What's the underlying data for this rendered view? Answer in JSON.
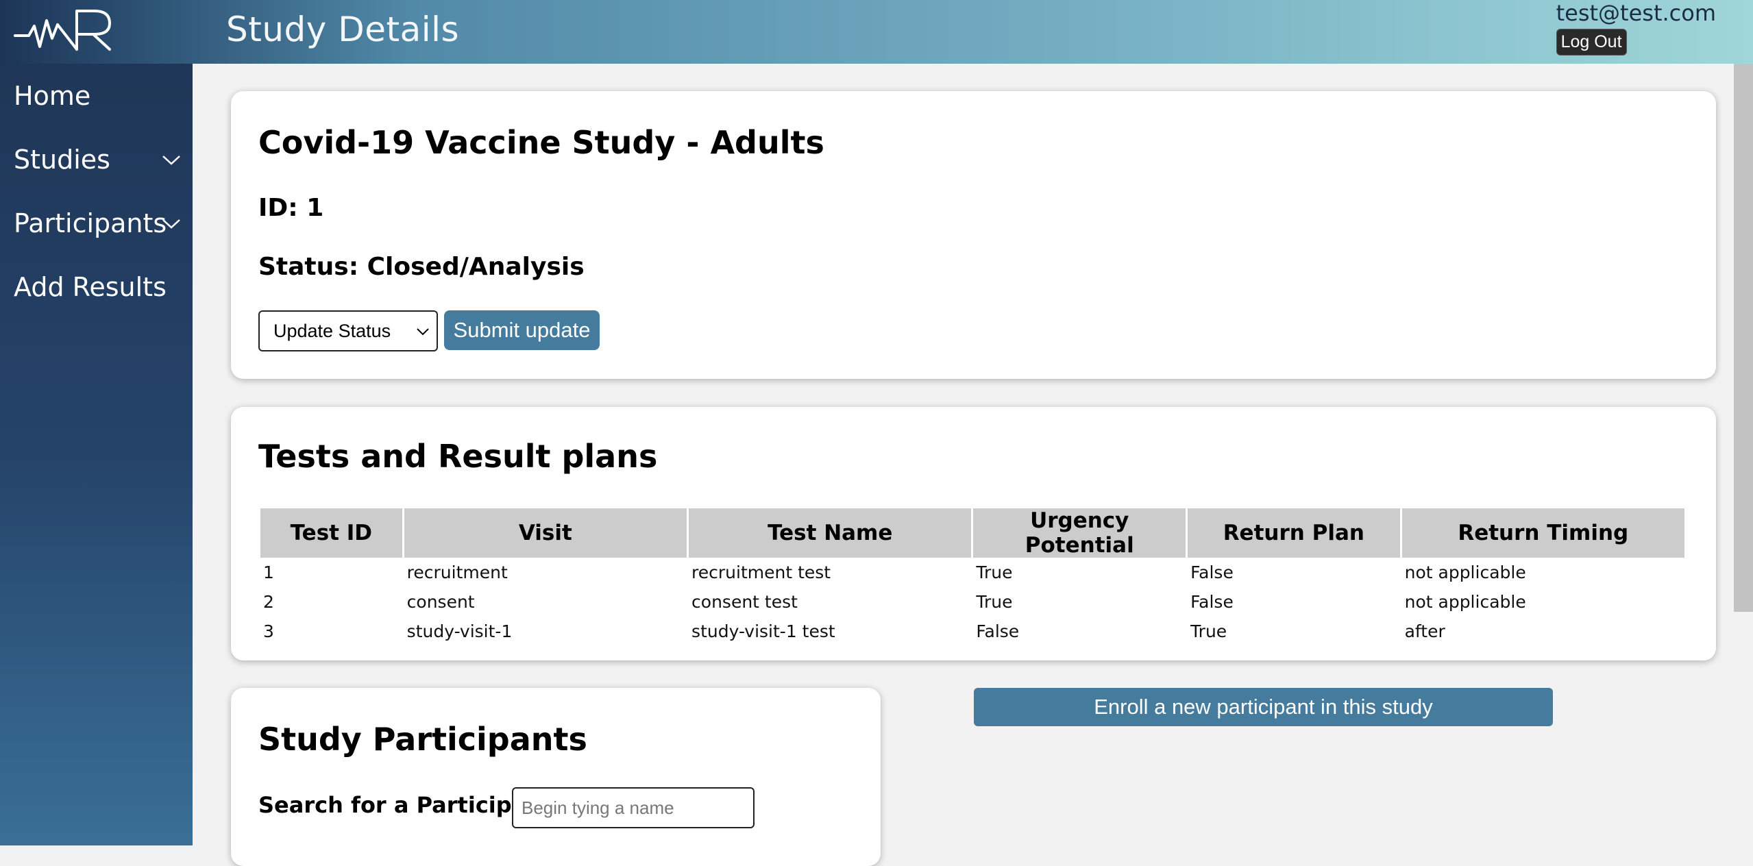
{
  "header": {
    "title": "Study Details",
    "user_email": "test@test.com",
    "logout_label": "Log Out"
  },
  "sidebar": {
    "items": [
      {
        "label": "Home"
      },
      {
        "label": "Studies"
      },
      {
        "label": "Participants"
      },
      {
        "label": "Add Results"
      }
    ]
  },
  "study": {
    "title": "Covid-19 Vaccine Study - Adults",
    "id_text": "ID: 1",
    "status_text": "Status: Closed/Analysis",
    "status_select_value": "Update Status",
    "submit_label": "Submit update"
  },
  "tests": {
    "title": "Tests and Result plans",
    "columns": [
      "Test ID",
      "Visit",
      "Test Name",
      "Urgency Potential",
      "Return Plan",
      "Return Timing"
    ],
    "rows": [
      [
        "1",
        "recruitment",
        "recruitment test",
        "True",
        "False",
        "not applicable"
      ],
      [
        "2",
        "consent",
        "consent test",
        "True",
        "False",
        "not applicable"
      ],
      [
        "3",
        "study-visit-1",
        "study-visit-1 test",
        "False",
        "True",
        "after"
      ]
    ]
  },
  "participants": {
    "title": "Study Participants",
    "search_label": "Search for a Participant:",
    "search_placeholder": "Begin tying a name",
    "search_value": ""
  },
  "enroll": {
    "label": "Enroll a new participant in this study"
  },
  "colors": {
    "button_blue": "#457b9d",
    "sidebar_dark": "#1f3657",
    "header_end": "#a0d6d9"
  }
}
